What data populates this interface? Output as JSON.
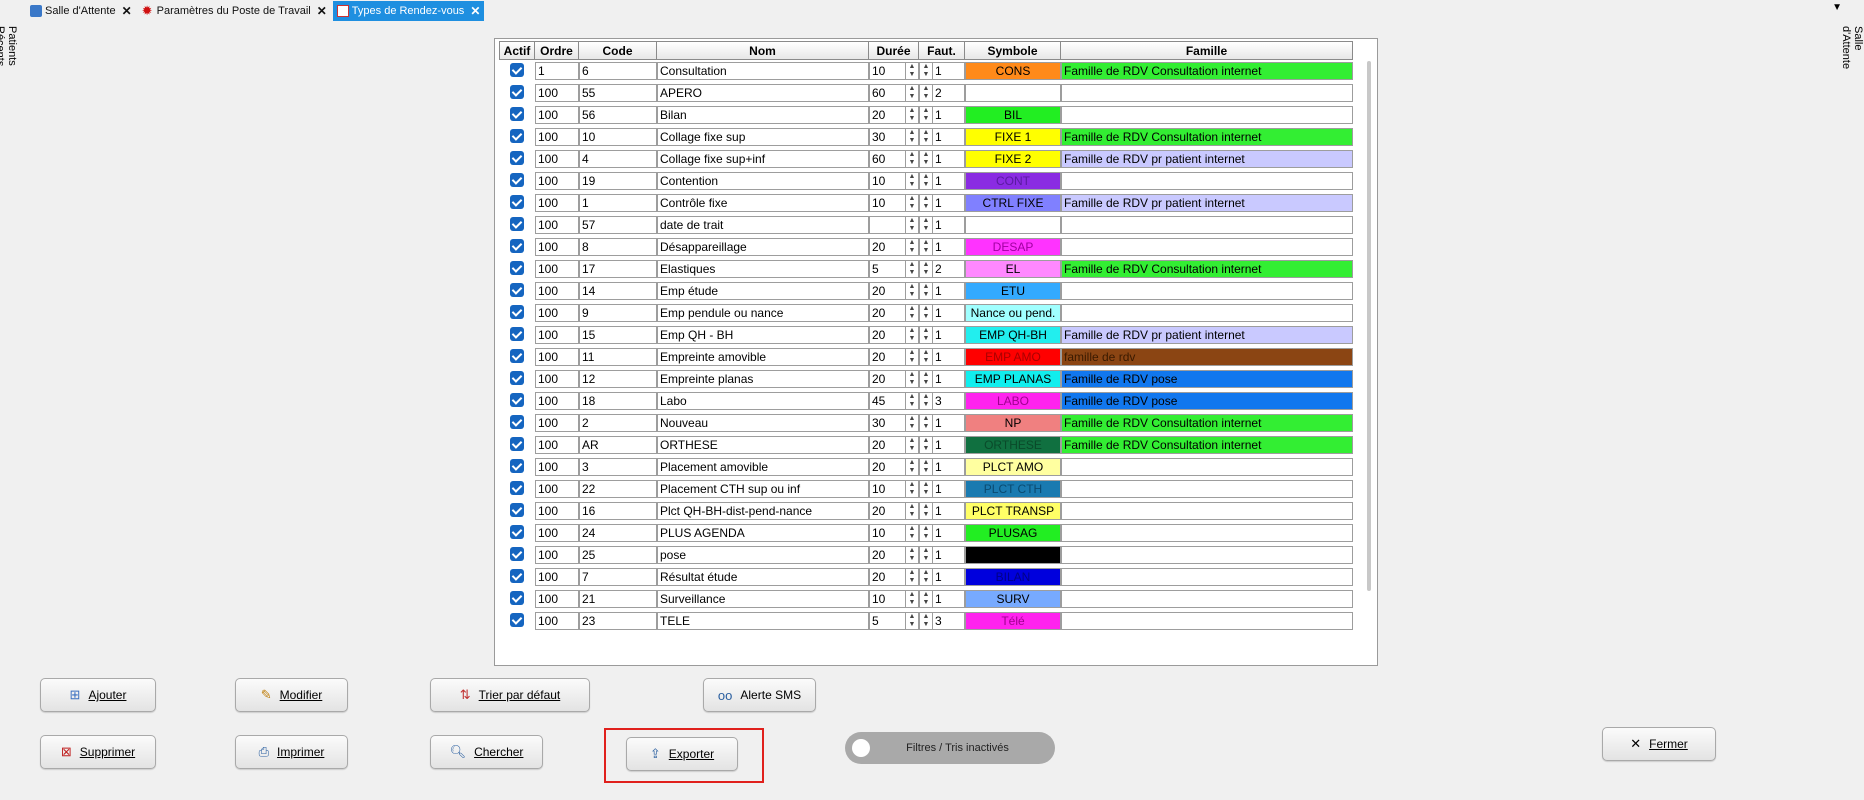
{
  "tabs": [
    {
      "label": "Salle d'Attente",
      "icon": "waiting-room-icon",
      "active": false
    },
    {
      "label": "Paramètres du Poste de Travail",
      "icon": "gear-icon",
      "active": false
    },
    {
      "label": "Types de Rendez-vous",
      "icon": "calendar-icon",
      "active": true
    }
  ],
  "side_left_label": "Patients Récents",
  "side_right_label": "Salle d'Attente",
  "table": {
    "headers": {
      "actif": "Actif",
      "ordre": "Ordre",
      "code": "Code",
      "nom": "Nom",
      "duree": "Durée",
      "faut": "Faut.",
      "symbole": "Symbole",
      "famille": "Famille"
    },
    "rows": [
      {
        "ordre": "1",
        "code": "6",
        "nom": "Consultation",
        "duree": "10",
        "faut": "1",
        "symbole": "CONS",
        "sym_bg": "#ff8a1a",
        "sym_fg": "#000000",
        "famille": "Famille de RDV Consultation internet",
        "fam_bg": "#33ee33",
        "fam_fg": "#000000"
      },
      {
        "ordre": "100",
        "code": "55",
        "nom": "APERO",
        "duree": "60",
        "faut": "2",
        "symbole": "",
        "sym_bg": "#ffffff",
        "sym_fg": "#000000",
        "famille": "",
        "fam_bg": "#ffffff",
        "fam_fg": "#000000"
      },
      {
        "ordre": "100",
        "code": "56",
        "nom": "Bilan",
        "duree": "20",
        "faut": "1",
        "symbole": "BIL",
        "sym_bg": "#22ee22",
        "sym_fg": "#000000",
        "famille": "",
        "fam_bg": "#ffffff",
        "fam_fg": "#000000"
      },
      {
        "ordre": "100",
        "code": "10",
        "nom": "Collage fixe sup",
        "duree": "30",
        "faut": "1",
        "symbole": "FIXE 1",
        "sym_bg": "#ffff00",
        "sym_fg": "#000000",
        "famille": "Famille de RDV Consultation internet",
        "fam_bg": "#33ee33",
        "fam_fg": "#000000"
      },
      {
        "ordre": "100",
        "code": "4",
        "nom": "Collage fixe sup+inf",
        "duree": "60",
        "faut": "1",
        "symbole": "FIXE 2",
        "sym_bg": "#ffff00",
        "sym_fg": "#000000",
        "famille": "Famille de RDV pr patient internet",
        "fam_bg": "#c9c9ff",
        "fam_fg": "#000000"
      },
      {
        "ordre": "100",
        "code": "19",
        "nom": "Contention",
        "duree": "10",
        "faut": "1",
        "symbole": "CONT",
        "sym_bg": "#8a2be2",
        "sym_fg": "#5a1aa0",
        "famille": "",
        "fam_bg": "#ffffff",
        "fam_fg": "#000000"
      },
      {
        "ordre": "100",
        "code": "1",
        "nom": "Contrôle fixe",
        "duree": "10",
        "faut": "1",
        "symbole": "CTRL FIXE",
        "sym_bg": "#8080ff",
        "sym_fg": "#000000",
        "famille": "Famille de RDV pr patient internet",
        "fam_bg": "#c9c9ff",
        "fam_fg": "#000000"
      },
      {
        "ordre": "100",
        "code": "57",
        "nom": "date de trait",
        "duree": "",
        "faut": "1",
        "symbole": "",
        "sym_bg": "#ffffff",
        "sym_fg": "#000000",
        "famille": "",
        "fam_bg": "#ffffff",
        "fam_fg": "#000000"
      },
      {
        "ordre": "100",
        "code": "8",
        "nom": "Désappareillage",
        "duree": "20",
        "faut": "1",
        "symbole": "DESAP",
        "sym_bg": "#ff33ff",
        "sym_fg": "#a000a0",
        "famille": "",
        "fam_bg": "#ffffff",
        "fam_fg": "#000000"
      },
      {
        "ordre": "100",
        "code": "17",
        "nom": "Elastiques",
        "duree": "5",
        "faut": "2",
        "symbole": "EL",
        "sym_bg": "#ff88ff",
        "sym_fg": "#000000",
        "famille": "Famille de RDV Consultation internet",
        "fam_bg": "#33ee33",
        "fam_fg": "#000000"
      },
      {
        "ordre": "100",
        "code": "14",
        "nom": "Emp étude",
        "duree": "20",
        "faut": "1",
        "symbole": "ETU",
        "sym_bg": "#33aaff",
        "sym_fg": "#000000",
        "famille": "",
        "fam_bg": "#ffffff",
        "fam_fg": "#000000"
      },
      {
        "ordre": "100",
        "code": "9",
        "nom": "Emp pendule ou nance",
        "duree": "20",
        "faut": "1",
        "symbole": "Nance ou pend.",
        "sym_bg": "#a0ffff",
        "sym_fg": "#000000",
        "famille": "",
        "fam_bg": "#ffffff",
        "fam_fg": "#000000"
      },
      {
        "ordre": "100",
        "code": "15",
        "nom": "Emp QH - BH",
        "duree": "20",
        "faut": "1",
        "symbole": "EMP QH-BH",
        "sym_bg": "#22eeee",
        "sym_fg": "#000000",
        "famille": "Famille de RDV pr patient internet",
        "fam_bg": "#c9c9ff",
        "fam_fg": "#000000"
      },
      {
        "ordre": "100",
        "code": "11",
        "nom": "Empreinte amovible",
        "duree": "20",
        "faut": "1",
        "symbole": "EMP AMO",
        "sym_bg": "#ff0000",
        "sym_fg": "#aa0000",
        "famille": "famille de rdv",
        "fam_bg": "#8b4513",
        "fam_fg": "#3a1a00"
      },
      {
        "ordre": "100",
        "code": "12",
        "nom": "Empreinte planas",
        "duree": "20",
        "faut": "1",
        "symbole": "EMP PLANAS",
        "sym_bg": "#11eeee",
        "sym_fg": "#000000",
        "famille": "Famille de RDV pose",
        "fam_bg": "#1177ee",
        "fam_fg": "#000000"
      },
      {
        "ordre": "100",
        "code": "18",
        "nom": "Labo",
        "duree": "45",
        "faut": "3",
        "symbole": "LABO",
        "sym_bg": "#ff22ee",
        "sym_fg": "#a00090",
        "famille": "Famille de RDV pose",
        "fam_bg": "#1177ee",
        "fam_fg": "#000000"
      },
      {
        "ordre": "100",
        "code": "2",
        "nom": "Nouveau",
        "duree": "30",
        "faut": "1",
        "symbole": "NP",
        "sym_bg": "#f08080",
        "sym_fg": "#000000",
        "famille": "Famille de RDV Consultation internet",
        "fam_bg": "#33ee33",
        "fam_fg": "#000000"
      },
      {
        "ordre": "100",
        "code": "AR",
        "nom": "ORTHESE",
        "duree": "20",
        "faut": "1",
        "symbole": "ORTHESE",
        "sym_bg": "#107040",
        "sym_fg": "#0a4a2a",
        "famille": "Famille de RDV Consultation internet",
        "fam_bg": "#33ee33",
        "fam_fg": "#000000"
      },
      {
        "ordre": "100",
        "code": "3",
        "nom": "Placement amovible",
        "duree": "20",
        "faut": "1",
        "symbole": "PLCT AMO",
        "sym_bg": "#ffffa0",
        "sym_fg": "#000000",
        "famille": "",
        "fam_bg": "#ffffff",
        "fam_fg": "#000000"
      },
      {
        "ordre": "100",
        "code": "22",
        "nom": "Placement CTH sup ou inf",
        "duree": "10",
        "faut": "1",
        "symbole": "PLCT CTH",
        "sym_bg": "#1a7ab0",
        "sym_fg": "#0a4a70",
        "famille": "",
        "fam_bg": "#ffffff",
        "fam_fg": "#000000"
      },
      {
        "ordre": "100",
        "code": "16",
        "nom": "Plct QH-BH-dist-pend-nance",
        "duree": "20",
        "faut": "1",
        "symbole": "PLCT TRANSP",
        "sym_bg": "#ffff66",
        "sym_fg": "#000000",
        "famille": "",
        "fam_bg": "#ffffff",
        "fam_fg": "#000000"
      },
      {
        "ordre": "100",
        "code": "24",
        "nom": "PLUS AGENDA",
        "duree": "10",
        "faut": "1",
        "symbole": "PLUSAG",
        "sym_bg": "#22ee22",
        "sym_fg": "#000000",
        "famille": "",
        "fam_bg": "#ffffff",
        "fam_fg": "#000000"
      },
      {
        "ordre": "100",
        "code": "25",
        "nom": "pose",
        "duree": "20",
        "faut": "1",
        "symbole": "",
        "sym_bg": "#000000",
        "sym_fg": "#000000",
        "famille": "",
        "fam_bg": "#ffffff",
        "fam_fg": "#000000"
      },
      {
        "ordre": "100",
        "code": "7",
        "nom": "Résultat étude",
        "duree": "20",
        "faut": "1",
        "symbole": "BILAN",
        "sym_bg": "#0000dd",
        "sym_fg": "#000088",
        "famille": "",
        "fam_bg": "#ffffff",
        "fam_fg": "#000000"
      },
      {
        "ordre": "100",
        "code": "21",
        "nom": "Surveillance",
        "duree": "10",
        "faut": "1",
        "symbole": "SURV",
        "sym_bg": "#77aaff",
        "sym_fg": "#000000",
        "famille": "",
        "fam_bg": "#ffffff",
        "fam_fg": "#000000"
      },
      {
        "ordre": "100",
        "code": "23",
        "nom": "TELE",
        "duree": "5",
        "faut": "3",
        "symbole": "Télé",
        "sym_bg": "#ff22ee",
        "sym_fg": "#a00090",
        "famille": "",
        "fam_bg": "#ffffff",
        "fam_fg": "#000000"
      }
    ]
  },
  "buttons": {
    "ajouter": "Ajouter",
    "modifier": "Modifier",
    "trier": "Trier par défaut",
    "alerte": "Alerte SMS",
    "supprimer": "Supprimer",
    "imprimer": "Imprimer",
    "chercher": "Chercher",
    "exporter": "Exporter",
    "fermer": "Fermer"
  },
  "toggle_label": "Filtres / Tris inactivés"
}
